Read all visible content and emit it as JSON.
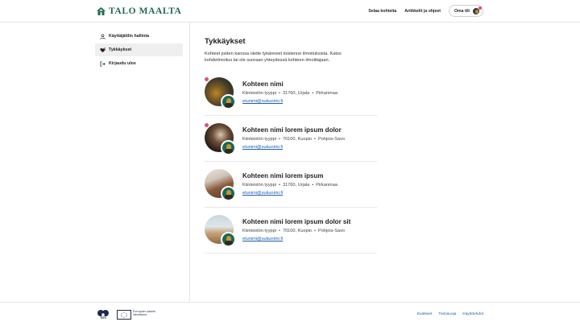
{
  "header": {
    "logo_text": "TALO MAALTA",
    "nav": [
      "Selaa kohteita",
      "Artikkelit ja ohjeet"
    ],
    "account_label": "Oma tili"
  },
  "sidebar": {
    "items": [
      {
        "label": "Käyttäjätilin hallinta",
        "icon": "user-icon"
      },
      {
        "label": "Tykkäykset",
        "icon": "heart-icon"
      },
      {
        "label": "Kirjaudu ulos",
        "icon": "logout-icon"
      }
    ]
  },
  "main": {
    "title": "Tykkäykset",
    "description": "Kohteet joiden kanssa olette tykänneet toistenne ilmoituksista. Katso kohdeilmoitus tai ole suoraan yhteydessä kohteen ilmoittajaan.",
    "cards": [
      {
        "title": "Kohteen nimi",
        "type": "Kiinteistön tyyppi",
        "location": "31760, Urjala",
        "region": "Pirkanmaa",
        "email": "etunimi@sukunimi.fi",
        "has_notification": true
      },
      {
        "title": "Kohteen nimi lorem ipsum dolor",
        "type": "Kiinteistön tyyppi",
        "location": "70100, Kuopio",
        "region": "Pohjois-Savo",
        "email": "etunimi@sukunimi.fi",
        "has_notification": true
      },
      {
        "title": "Kohteen nimi lorem ipsum",
        "type": "Kiinteistön tyyppi",
        "location": "31760, Urjala",
        "region": "Pirkanmaa",
        "email": "etunimi@sukunimi.fi",
        "has_notification": false
      },
      {
        "title": "Kohteen nimi lorem ipsum dolor sit",
        "type": "Kiinteistön tyyppi",
        "location": "70100, Kuopio",
        "region": "Pohjois-Savo",
        "email": "etunimi@sukunimi.fi",
        "has_notification": false
      }
    ]
  },
  "footer": {
    "mtk_label": "MTK",
    "eu_text": "Euroopan unionin rahoittama",
    "links": [
      "Evästeet",
      "Tietosuoja",
      "Käyttöehdot"
    ]
  },
  "colors": {
    "brand": "#1d6b4f",
    "link": "#1a5fb4",
    "notification": "#e64a8b"
  }
}
